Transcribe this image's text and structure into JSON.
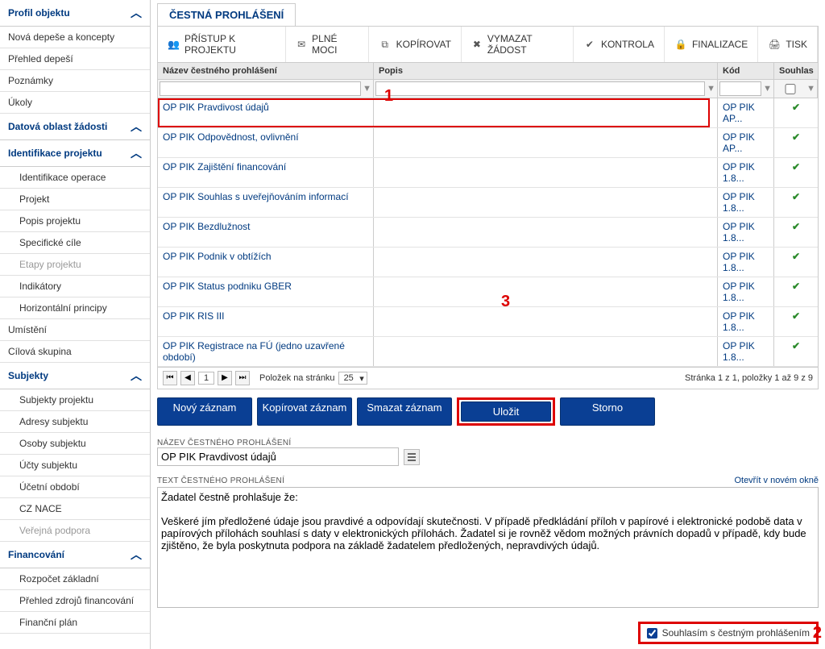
{
  "sidebar": {
    "section1": {
      "label": "Profil objektu",
      "items": [
        "Nová depeše a koncepty",
        "Přehled depeší",
        "Poznámky",
        "Úkoly"
      ]
    },
    "section2": {
      "label": "Datová oblast žádosti"
    },
    "section3": {
      "label": "Identifikace projektu",
      "items": [
        "Identifikace operace",
        "Projekt",
        "Popis projektu",
        "Specifické cíle",
        "Etapy projektu",
        "Indikátory",
        "Horizontální principy"
      ]
    },
    "section4": {
      "items": [
        "Umístění",
        "Cílová skupina"
      ]
    },
    "section5": {
      "label": "Subjekty",
      "items": [
        "Subjekty projektu",
        "Adresy subjektu",
        "Osoby subjektu",
        "Účty subjektu",
        "Účetní období",
        "CZ NACE",
        "Veřejná podpora"
      ]
    },
    "section6": {
      "label": "Financování",
      "items": [
        "Rozpočet základní",
        "Přehled zdrojů financování",
        "Finanční plán"
      ]
    }
  },
  "header": {
    "tab": "ČESTNÁ PROHLÁŠENÍ"
  },
  "toolbar": {
    "access": "PŘÍSTUP K PROJEKTU",
    "powers": "PLNÉ MOCI",
    "copy": "KOPÍROVAT",
    "delete": "VYMAZAT ŽÁDOST",
    "check": "KONTROLA",
    "finalize": "FINALIZACE",
    "print": "TISK"
  },
  "grid": {
    "headers": {
      "name": "Název čestného prohlášení",
      "popis": "Popis",
      "kod": "Kód",
      "souhlas": "Souhlas"
    },
    "rows": [
      {
        "name": "OP PIK Pravdivost údajů",
        "popis": "",
        "kod": "OP PIK AP..."
      },
      {
        "name": "OP PIK Odpovědnost, ovlivnění",
        "popis": "",
        "kod": "OP PIK AP..."
      },
      {
        "name": "OP PIK Zajištění financování",
        "popis": "",
        "kod": "OP PIK 1.8..."
      },
      {
        "name": "OP PIK Souhlas s uveřejňováním informací",
        "popis": "",
        "kod": "OP PIK 1.8..."
      },
      {
        "name": "OP PIK Bezdlužnost",
        "popis": "",
        "kod": "OP PIK 1.8..."
      },
      {
        "name": "OP PIK Podnik v obtížích",
        "popis": "",
        "kod": "OP PIK 1.8..."
      },
      {
        "name": "OP PIK Status podniku GBER",
        "popis": "",
        "kod": "OP PIK 1.8..."
      },
      {
        "name": "OP PIK RIS III",
        "popis": "",
        "kod": "OP PIK 1.8..."
      },
      {
        "name": "OP PIK Registrace na FÚ (jedno uzavřené období)",
        "popis": "",
        "kod": "OP PIK 1.8..."
      }
    ]
  },
  "pager": {
    "page": "1",
    "per_page_label": "Položek na stránku",
    "per_page_value": "25",
    "summary": "Stránka 1 z 1, položky 1 až 9 z 9"
  },
  "actions": {
    "new": "Nový záznam",
    "copy": "Kopírovat záznam",
    "delete": "Smazat záznam",
    "save": "Uložit",
    "cancel": "Storno"
  },
  "form": {
    "name_label": "NÁZEV ČESTNÉHO PROHLÁŠENÍ",
    "name_value": "OP PIK Pravdivost údajů",
    "text_label": "TEXT ČESTNÉHO PROHLÁŠENÍ",
    "open_link": "Otevřít v novém okně",
    "text_value": "Žadatel čestně prohlašuje že:\n\nVeškeré jím předložené údaje jsou pravdivé a odpovídají skutečnosti. V případě předkládání příloh v papírové i elektronické podobě data v papírových přílohách souhlasí s daty v elektronických přílohách. Žadatel si je rovněž vědom možných právních dopadů v případě, kdy bude zjištěno, že byla poskytnuta podpora na základě žadatelem předložených, nepravdivých údajů.",
    "agree_label": "Souhlasím s čestným prohlášením"
  },
  "annotations": {
    "a1": "1",
    "a2": "2",
    "a3": "3"
  }
}
